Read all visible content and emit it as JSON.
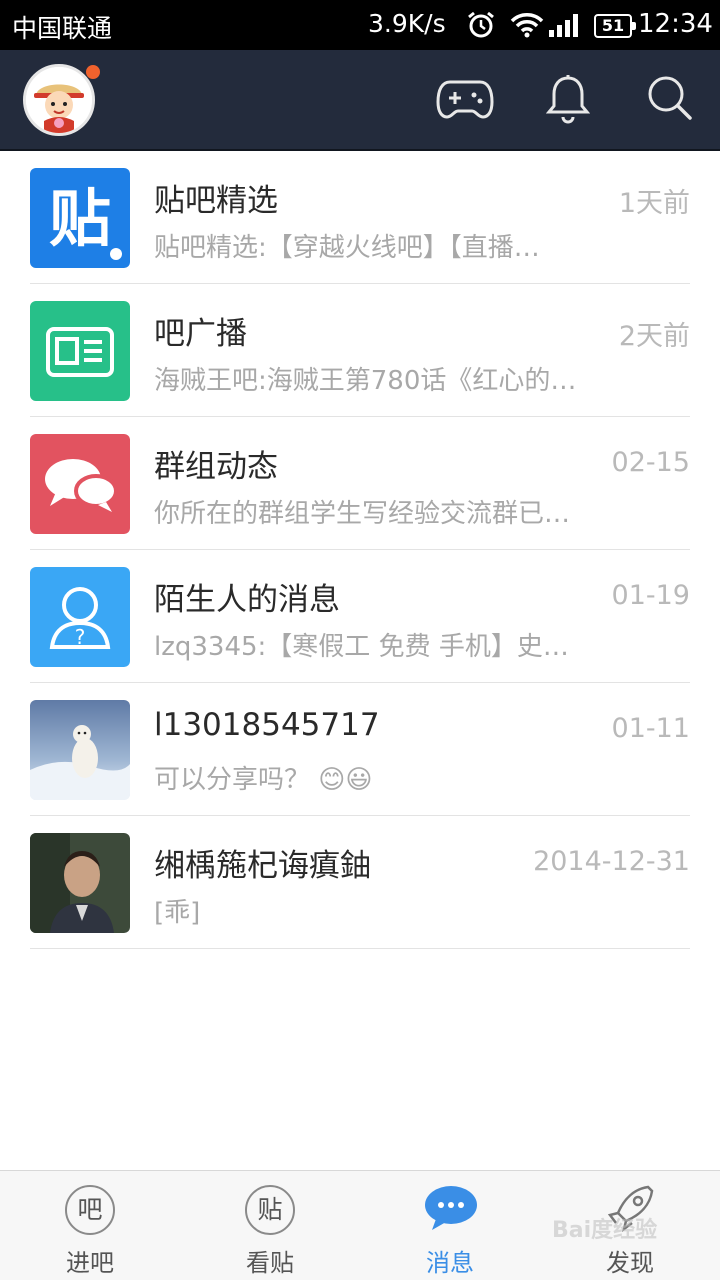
{
  "status_bar": {
    "carrier": "中国联通",
    "speed": "3.9K/s",
    "battery": "51",
    "time": "12:34",
    "icons": [
      "alarm-icon",
      "wifi-icon",
      "signal-icon",
      "battery-icon"
    ]
  },
  "header": {
    "icons": [
      "game-controller-icon",
      "bell-icon",
      "search-icon"
    ],
    "badge_color": "#f0622d",
    "background": "#232b3c"
  },
  "messages": [
    {
      "name": "贴吧精选",
      "time": "1天前",
      "preview": "贴吧精选:【穿越火线吧】【直播…",
      "thumb": "tieba-featured-icon",
      "color": "#1e7fe6",
      "badge_text": "贴"
    },
    {
      "name": "吧广播",
      "time": "2天前",
      "preview": "海贼王吧:海贼王第780话《红心的…",
      "thumb": "broadcast-card-icon",
      "color": "#27c089"
    },
    {
      "name": "群组动态",
      "time": "02-15",
      "preview": "你所在的群组学生写经验交流群已…",
      "thumb": "chat-bubbles-icon",
      "color": "#e25360"
    },
    {
      "name": "陌生人的消息",
      "time": "01-19",
      "preview": "lzq3345:【寒假工 免费 手机】史…",
      "thumb": "stranger-person-icon",
      "color": "#3aa7f5"
    },
    {
      "name": "l13018545717",
      "time": "01-11",
      "preview": "可以分享吗？ 😊😃",
      "thumb": "polar-bear-photo"
    },
    {
      "name": "缃楀箷杞诲瘨鈾",
      "time": "2014-12-31",
      "preview": "[乖]",
      "thumb": "man-portrait-photo"
    }
  ],
  "bottom_nav": {
    "tabs": [
      {
        "label": "进吧",
        "icon_text": "吧"
      },
      {
        "label": "看贴",
        "icon_text": "贴"
      },
      {
        "label": "消息",
        "icon_text": ""
      },
      {
        "label": "发现",
        "icon_text": ""
      }
    ],
    "active_color": "#3a8ee6"
  },
  "watermark": "Bai度经验"
}
